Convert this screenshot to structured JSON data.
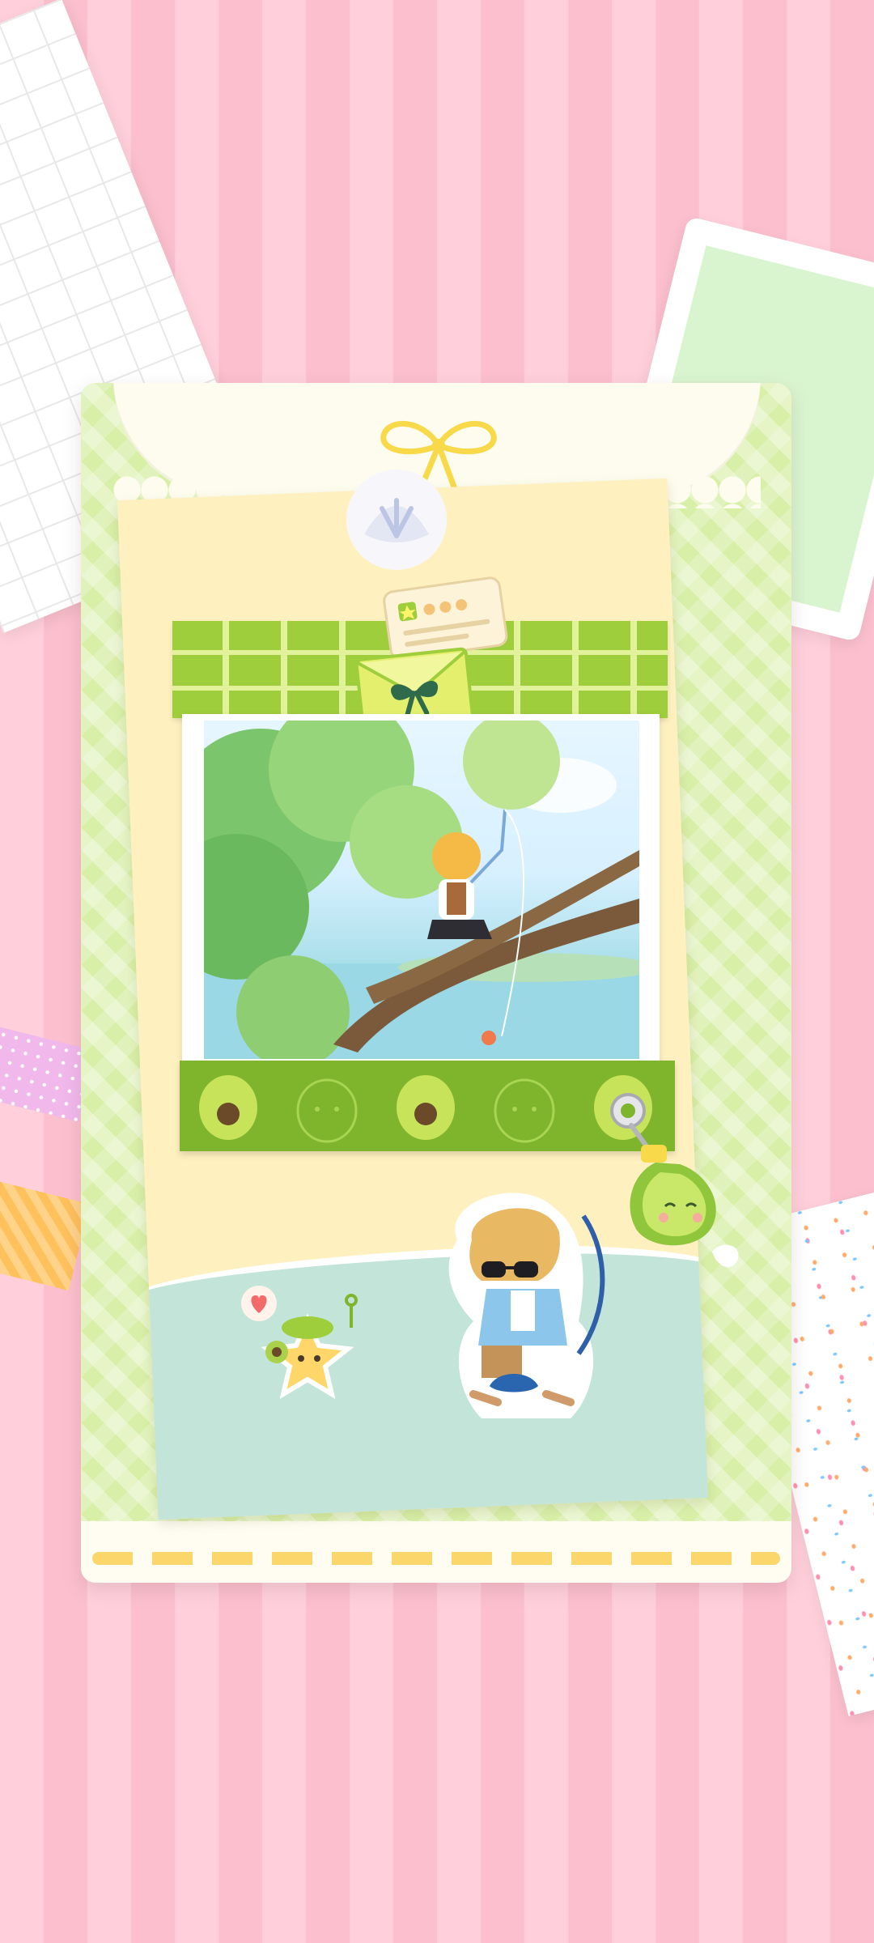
{
  "screen": {
    "name": "photo-card-collection",
    "background_color": "#ffd0dc",
    "card_color": "#d8efa8",
    "paper_color": "#fff1bf",
    "accent_green": "#7fb52d",
    "accent_yellow": "#fbd66a"
  },
  "decor": {
    "top_icon": "bow-ribbon-icon",
    "badge_icon": "shell-badge-icon",
    "envelope_icon": "green-envelope-icon",
    "note_icon": "message-note-icon",
    "photo_subject": "character-fishing-on-tree-branch",
    "strip_icons": [
      "avocado-icon",
      "pear-outline-icon",
      "avocado-icon",
      "pear-outline-icon",
      "avocado-icon"
    ],
    "charm_icon": "pear-keychain-charm-icon",
    "sticker_left": "star-sprite-sticker-icon",
    "sticker_right": "sunglasses-character-sticker-icon",
    "heart_icon": "heart-bubble-icon"
  }
}
